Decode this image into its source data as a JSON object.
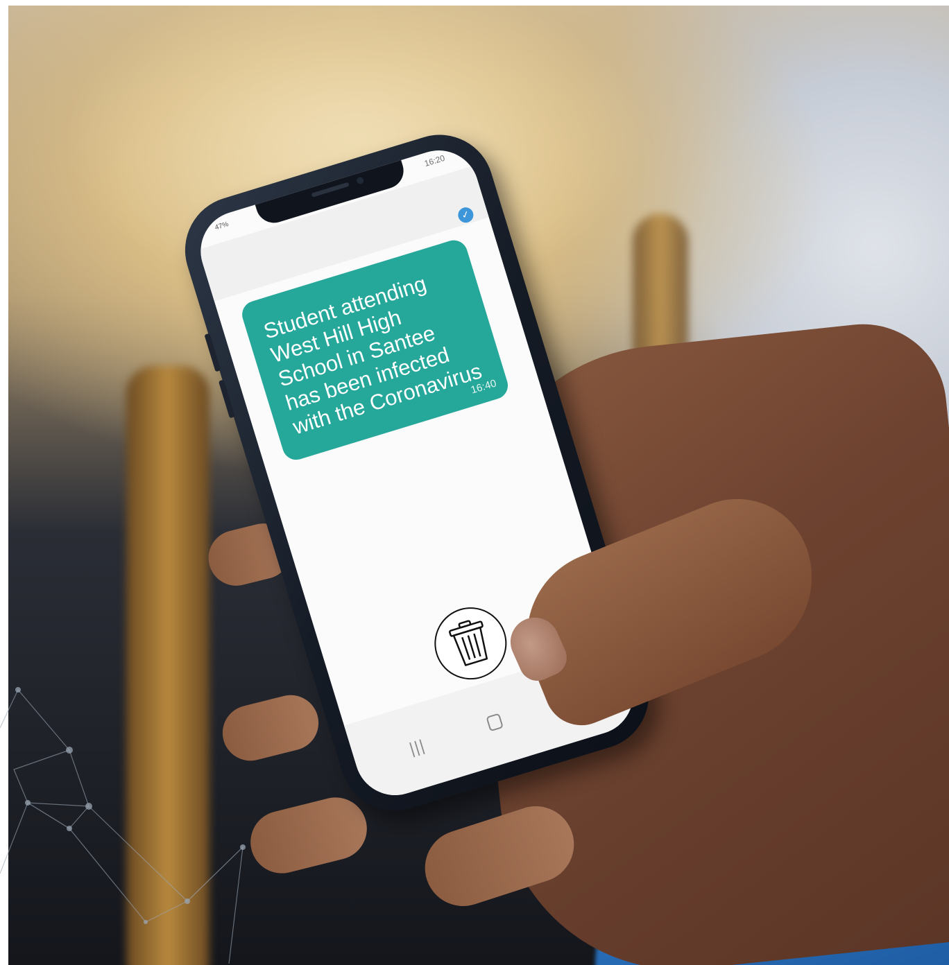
{
  "phone": {
    "status": {
      "left": "47%",
      "time": "16:20"
    },
    "message": {
      "lines": [
        "Student attending",
        "West Hill High",
        "School in Santee",
        "has been infected",
        "with the Coronavirus"
      ],
      "time": "16:40",
      "read_icon": "check-circle-icon"
    },
    "action_icon": "trash-icon",
    "nav": {
      "recents": "|||",
      "back": "›"
    }
  },
  "colors": {
    "bubble": "#25a79a",
    "check": "#3d96da",
    "cushion": "#2f78c4"
  }
}
